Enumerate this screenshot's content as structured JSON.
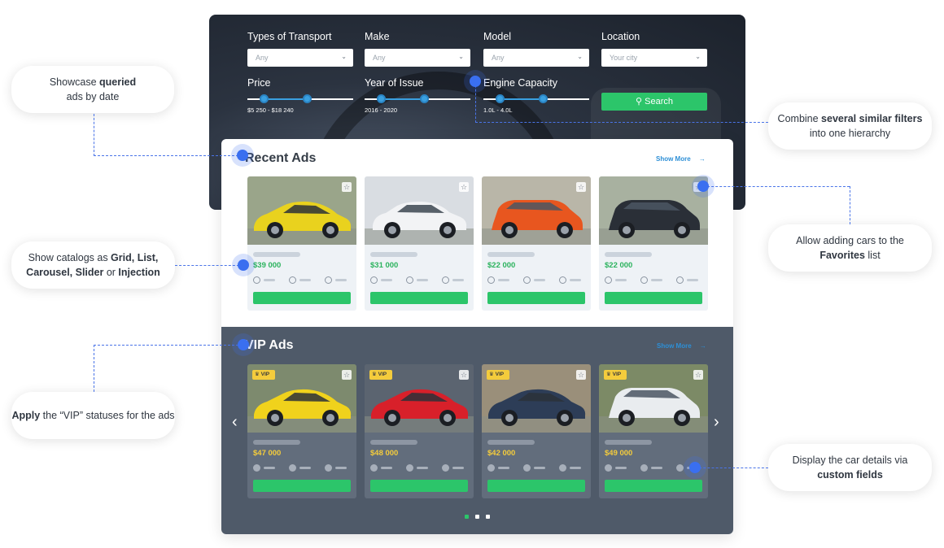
{
  "filters": {
    "transport": {
      "label": "Types of Transport",
      "value": "Any"
    },
    "make": {
      "label": "Make",
      "value": "Any"
    },
    "model": {
      "label": "Model",
      "value": "Any"
    },
    "location": {
      "label": "Location",
      "placeholder": "Your city"
    },
    "price": {
      "label": "Price",
      "range_text": "$5 250 - $18 240",
      "low": 0.15,
      "high": 0.56
    },
    "year": {
      "label": "Year of Issue",
      "range_text": "2016 - 2020",
      "low": 0.15,
      "high": 0.56
    },
    "engine": {
      "label": "Engine Capacity",
      "range_text": "1.0L - 4.0L",
      "low": 0.15,
      "high": 0.56
    },
    "search_button": "Search"
  },
  "recent": {
    "title": "Recent Ads",
    "show_more": "Show More",
    "cards": [
      {
        "price": "$39 000",
        "car": "yellow hatchback",
        "color": "#e9d21e"
      },
      {
        "price": "$31 000",
        "car": "white sedan",
        "color": "#f2f3f5"
      },
      {
        "price": "$22 000",
        "car": "orange crossover",
        "color": "#e8561f"
      },
      {
        "price": "$22 000",
        "car": "black SUV",
        "color": "#2a2f37"
      }
    ]
  },
  "vip": {
    "title": "VIP Ads",
    "show_more": "Show More",
    "badge": "VIP",
    "cards": [
      {
        "price": "$47 000",
        "car": "yellow sports car",
        "color": "#f0d21c"
      },
      {
        "price": "$48 000",
        "car": "red muscle car",
        "color": "#d8202a"
      },
      {
        "price": "$42 000",
        "car": "blue sports coupe",
        "color": "#2d3d57"
      },
      {
        "price": "$49 000",
        "car": "white SUV",
        "color": "#e9ecef"
      }
    ],
    "pagination": {
      "pages": 3,
      "active": 1
    }
  },
  "callouts": {
    "queried": [
      "Showcase ",
      "queried",
      " ads by date"
    ],
    "combine": [
      "Combine ",
      "several similar filters",
      " into one hierarchy"
    ],
    "catalogs": [
      "Show catalogs as ",
      "Grid, List, Carousel, Slider",
      " or ",
      "Injection"
    ],
    "favorites": [
      "Allow adding cars to the ",
      "Favorites",
      " list"
    ],
    "vip": [
      "Apply",
      " the “VIP” statuses for the ads"
    ],
    "fields": [
      "Display the car details via ",
      "custom fields"
    ]
  },
  "colors": {
    "accent_green": "#2cc56a",
    "accent_blue": "#2d8fd6",
    "vip_yellow": "#f4cc3c",
    "dark_section": "#4f5a69"
  }
}
